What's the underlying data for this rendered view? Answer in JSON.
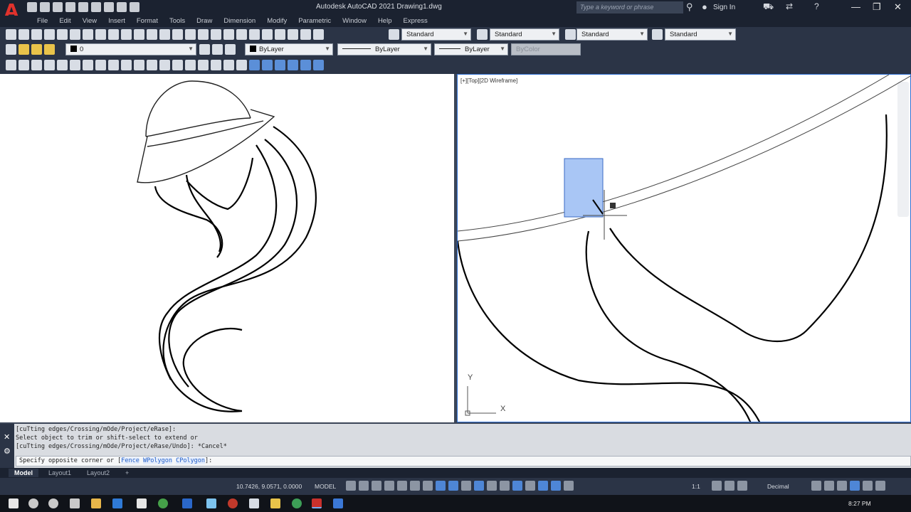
{
  "titlebar": {
    "logo": "A",
    "title": "Autodesk AutoCAD 2021   Drawing1.dwg",
    "search_placeholder": "Type a keyword or phrase",
    "signin": "Sign In",
    "win_minimize": "—",
    "win_maximize": "❐",
    "win_close": "✕"
  },
  "menu": [
    "File",
    "Edit",
    "View",
    "Insert",
    "Format",
    "Tools",
    "Draw",
    "Dimension",
    "Modify",
    "Parametric",
    "Window",
    "Help",
    "Express"
  ],
  "toolbar": {
    "text_style": "Standard",
    "dim_style": "Standard",
    "table_style": "Standard",
    "multileader_style": "Standard",
    "layer": "0",
    "color": "ByLayer",
    "linetype": "ByLayer",
    "lineweight": "ByLayer",
    "plotstyle": "ByColor"
  },
  "viewport_right": {
    "label": "[+][Top][2D Wireframe]",
    "ucs_y": "Y",
    "ucs_x": "X"
  },
  "command": {
    "history": [
      "[cuTting edges/Crossing/mOde/Project/eRase]:",
      "Select object to trim or shift-select to extend or",
      "[cuTting edges/Crossing/mOde/Project/eRase/Undo]: *Cancel*"
    ],
    "prompt": "Specify opposite corner or [",
    "opt_fence": "Fence",
    "opt_wpolygon": "WPolygon",
    "opt_cpolygon": "CPolygon",
    "prompt_end": "]:"
  },
  "tabs": {
    "model": "Model",
    "layout1": "Layout1",
    "layout2": "Layout2",
    "add": "+"
  },
  "status": {
    "coords": "10.7426, 9.0571, 0.0000",
    "model": "MODEL",
    "scale": "1:1",
    "units": "Decimal"
  },
  "taskbar": {
    "time": "8:27 PM"
  },
  "colors": {
    "autocad_red": "#e0322c",
    "accent_blue": "#2f6fd1",
    "selection_fill": "#a9c6f5"
  }
}
